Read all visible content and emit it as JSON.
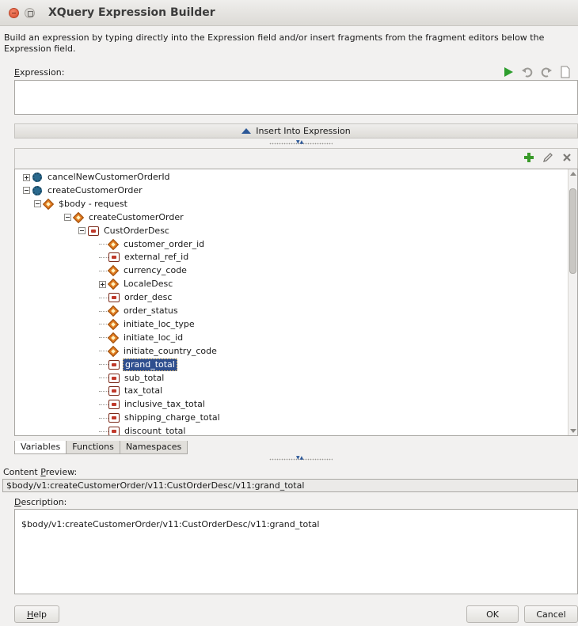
{
  "window": {
    "title": "XQuery Expression Builder"
  },
  "instructions": "Build an expression by typing directly into the Expression field and/or insert fragments from the fragment editors below the Expression field.",
  "expression": {
    "label_mnemonic": "E",
    "label_rest": "xpression:",
    "value": ""
  },
  "insert_bar": {
    "label": "Insert Into Expression"
  },
  "tree": {
    "rows": [
      {
        "label": "cancelNewCustomerOrderId",
        "icon": "gear-icon",
        "expander": "plus",
        "level": 0
      },
      {
        "label": "createCustomerOrder",
        "icon": "gear-icon",
        "expander": "minus",
        "level": 0
      },
      {
        "label": "$body - request",
        "icon": "diamond-icon",
        "expander": "minus",
        "level": 1
      },
      {
        "label": "createCustomerOrder",
        "icon": "diamond-icon",
        "expander": "minus",
        "level": 2
      },
      {
        "label": "CustOrderDesc",
        "icon": "bracket-icon",
        "expander": "minus",
        "level": 3
      },
      {
        "label": "customer_order_id",
        "icon": "diamond-icon",
        "expander": "none",
        "level": 4
      },
      {
        "label": "external_ref_id",
        "icon": "bracket-icon",
        "expander": "none",
        "level": 4
      },
      {
        "label": "currency_code",
        "icon": "diamond-icon",
        "expander": "none",
        "level": 4
      },
      {
        "label": "LocaleDesc",
        "icon": "diamond-icon",
        "expander": "plus",
        "level": 4
      },
      {
        "label": "order_desc",
        "icon": "bracket-icon",
        "expander": "none",
        "level": 4
      },
      {
        "label": "order_status",
        "icon": "diamond-icon",
        "expander": "none",
        "level": 4
      },
      {
        "label": "initiate_loc_type",
        "icon": "diamond-icon",
        "expander": "none",
        "level": 4
      },
      {
        "label": "initiate_loc_id",
        "icon": "diamond-icon",
        "expander": "none",
        "level": 4
      },
      {
        "label": "initiate_country_code",
        "icon": "diamond-icon",
        "expander": "none",
        "level": 4
      },
      {
        "label": "grand_total",
        "icon": "bracket-icon",
        "expander": "none",
        "level": 4,
        "selected": true
      },
      {
        "label": "sub_total",
        "icon": "bracket-icon",
        "expander": "none",
        "level": 4
      },
      {
        "label": "tax_total",
        "icon": "bracket-icon",
        "expander": "none",
        "level": 4
      },
      {
        "label": "inclusive_tax_total",
        "icon": "bracket-icon",
        "expander": "none",
        "level": 4
      },
      {
        "label": "shipping_charge_total",
        "icon": "bracket-icon",
        "expander": "none",
        "level": 4
      },
      {
        "label": "discount_total",
        "icon": "bracket-icon",
        "expander": "none",
        "level": 4
      }
    ]
  },
  "tabs": {
    "variables": "Variables",
    "functions": "Functions",
    "namespaces": "Namespaces"
  },
  "content_preview": {
    "label_prefix": "Content ",
    "label_mnemonic": "P",
    "label_rest": "review:",
    "value": "$body/v1:createCustomerOrder/v11:CustOrderDesc/v11:grand_total"
  },
  "description": {
    "label_mnemonic": "D",
    "label_rest": "escription:",
    "value": "$body/v1:createCustomerOrder/v11:CustOrderDesc/v11:grand_total"
  },
  "buttons": {
    "help_mnemonic": "H",
    "help_rest": "elp",
    "ok": "OK",
    "cancel": "Cancel"
  },
  "colors": {
    "selection": "#2f4f8f",
    "run": "#2e9e2e",
    "add": "#3a9a2a"
  }
}
